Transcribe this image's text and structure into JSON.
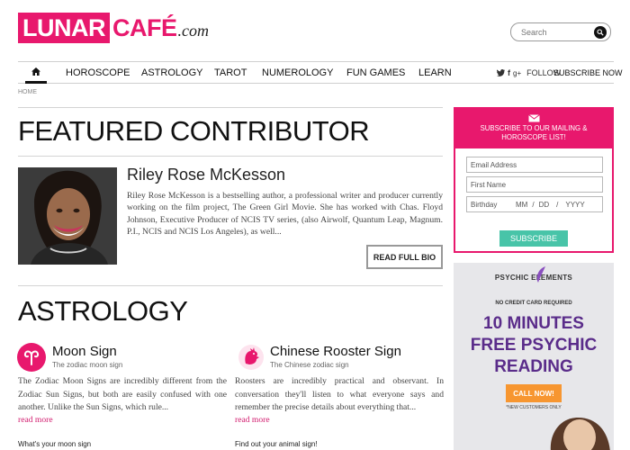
{
  "brand": {
    "logo_box": "LUNAR",
    "logo_rest": "CAFÉ",
    "logo_com": ".com",
    "accent": "#e8186d"
  },
  "search": {
    "placeholder": "Search"
  },
  "nav": {
    "items": [
      "HOROSCOPE",
      "ASTROLOGY",
      "TAROT",
      "NUMEROLOGY",
      "FUN GAMES",
      "LEARN"
    ],
    "follow": "FOLLOW",
    "subscribe": "SUBSCRIBE NOW"
  },
  "breadcrumb": "HOME",
  "featured": {
    "heading": "FEATURED CONTRIBUTOR",
    "name": "Riley Rose McKesson",
    "bio": "Riley Rose McKesson is a bestselling author, a professional writer and producer currently working on the film project, The Green Girl Movie. She has worked with Chas. Floyd Johnson, Executive Producer of NCIS TV series, (also Airwolf, Quantum Leap, Magnum. P.I., NCIS and NCIS Los Angeles), as well...",
    "button": "READ FULL BIO"
  },
  "astrology": {
    "heading": "ASTROLOGY",
    "cards": [
      {
        "title": "Moon Sign",
        "subtitle": "The zodiac moon sign",
        "text": "The Zodiac Moon Signs are incredibly different from the Zodiac Sun Signs, but both are easily confused with one another. Unlike the Sun Signs, which rule...",
        "read_more": "read more",
        "footer": "What's your moon sign",
        "icon": "aries-icon"
      },
      {
        "title": "Chinese Rooster Sign",
        "subtitle": "The Chinese zodiac sign",
        "text": "Roosters are incredibly practical and observant. In conversation they'll listen to what everyone says and remember the precise details about everything that...",
        "read_more": "read more",
        "footer": "Find out your animal sign!",
        "icon": "rooster-icon"
      }
    ]
  },
  "mailing": {
    "line1": "SUBSCRIBE TO OUR MAILING &",
    "line2": "HOROSCOPE LIST!",
    "email_placeholder": "Email Address",
    "name_placeholder": "First Name",
    "birthday_label": "Birthday",
    "mm": "MM",
    "dd": "DD",
    "yyyy": "YYYY",
    "separator": "/",
    "button": "SUBSCRIBE",
    "button_color": "#48c4a8"
  },
  "ad": {
    "brand": "PSYCHIC ELEMENTS",
    "no_cc": "NO CREDIT CARD REQUIRED",
    "line1": "10 MINUTES",
    "line2": "FREE PSYCHIC",
    "line3": "READING",
    "cta": "CALL NOW!",
    "note": "*NEW CUSTOMERS ONLY"
  }
}
